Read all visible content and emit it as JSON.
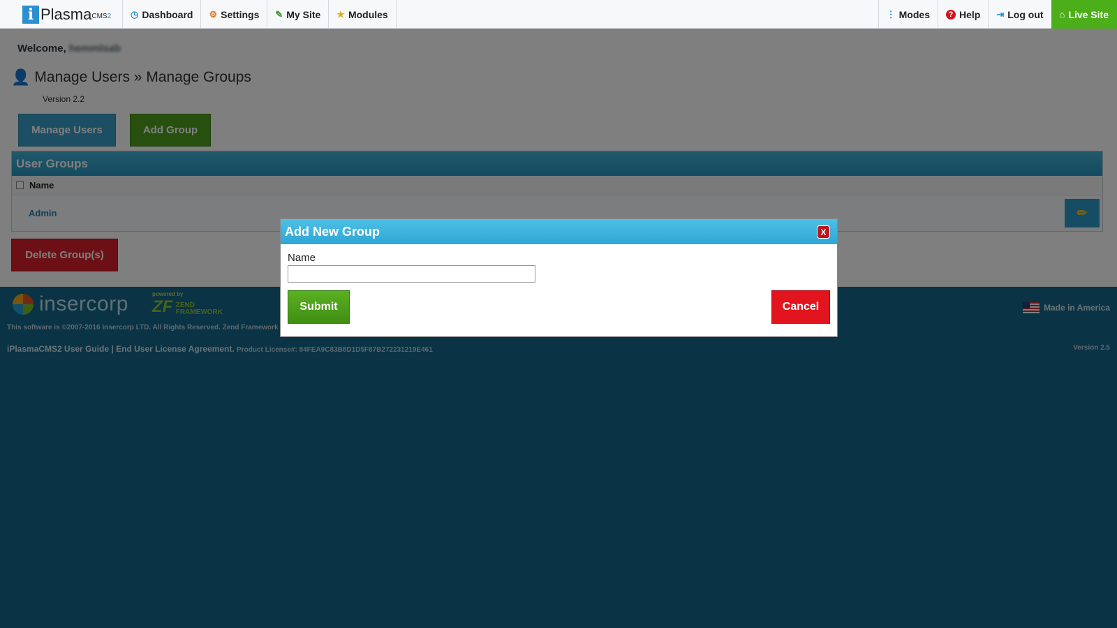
{
  "app": {
    "logo_letter": "i",
    "logo_name": "Plasma",
    "logo_sup": "CMS",
    "logo_sup_version": "2"
  },
  "nav": {
    "left": [
      {
        "label": "Dashboard",
        "icon": "dashboard-icon",
        "glyph": "◷",
        "color": "#2b8fd0"
      },
      {
        "label": "Settings",
        "icon": "gear-icon",
        "glyph": "⚙",
        "color": "#e07a1f"
      },
      {
        "label": "My Site",
        "icon": "edit-icon",
        "glyph": "✎",
        "color": "#3a9a2a"
      },
      {
        "label": "Modules",
        "icon": "star-icon",
        "glyph": "★",
        "color": "#e0b020"
      }
    ],
    "right": [
      {
        "label": "Modes",
        "icon": "dots-vertical-icon",
        "glyph": "⋮",
        "color": "#2b8fd0"
      },
      {
        "label": "Help",
        "icon": "help-icon",
        "glyph": "?",
        "color": "#d0141c"
      },
      {
        "label": "Log out",
        "icon": "logout-icon",
        "glyph": "⇥",
        "color": "#2b8fd0"
      }
    ],
    "live_site": {
      "label": "Live Site",
      "icon": "home-icon",
      "glyph": "⌂"
    }
  },
  "page": {
    "welcome_label": "Welcome,",
    "welcome_name": "hemmlsab",
    "breadcrumb": "Manage Users » Manage Groups",
    "version": "Version 2.2",
    "manage_users_button": "Manage Users",
    "add_group_button": "Add Group",
    "groups_header": "User Groups",
    "column_name": "Name",
    "groups": [
      {
        "name": "Admin"
      }
    ],
    "delete_button": "Delete Group(s)"
  },
  "footer": {
    "brand": "insercorp",
    "powered_by": "powered by",
    "zend_mark": "ZF",
    "zend_name_1": "ZEND",
    "zend_name_2": "FRAMEWORK",
    "copyright": "This software is ©2007-2016 Insercorp LTD. All Rights Reserved. Zend Framework i",
    "guide_link": "iPlasmaCMS2 User Guide",
    "separator": "|",
    "eula_link": "End User License Agreement.",
    "license": "Product License#: 84FEA9C83B8D1D5F87B272231219E461",
    "made_in": "Made in America",
    "version": "Version 2.5"
  },
  "modal": {
    "title": "Add New Group",
    "close_label": "X",
    "name_label": "Name",
    "name_value": "",
    "submit_label": "Submit",
    "cancel_label": "Cancel"
  }
}
